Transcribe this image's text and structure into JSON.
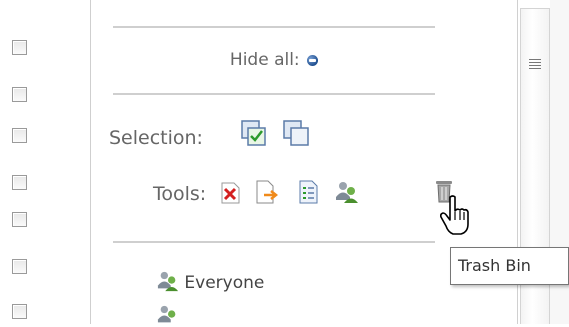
{
  "panel": {
    "hide_all_label": "Hide all:",
    "selection_label": "Selection:",
    "tools_label": "Tools:"
  },
  "tools": [
    {
      "icon": "delete-x-icon"
    },
    {
      "icon": "export-arrow-icon"
    },
    {
      "icon": "properties-icon"
    },
    {
      "icon": "users-group-icon"
    },
    {
      "icon": "trash-bin-icon"
    }
  ],
  "list": {
    "items": [
      {
        "label": "Everyone",
        "icon": "users-group-icon"
      }
    ]
  },
  "tooltip": {
    "text": "Trash Bin"
  },
  "colors": {
    "accent_blue": "#1f4f8f",
    "divider": "#cfcfcf"
  }
}
